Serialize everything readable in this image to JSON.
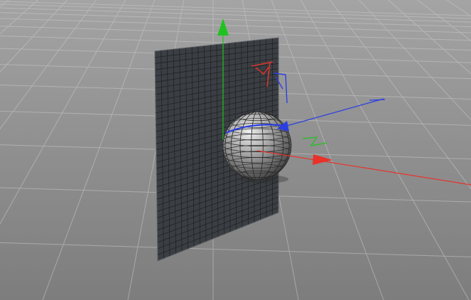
{
  "viewport": {
    "background_top": "#a4a4a4",
    "background_bottom": "#7d7d7d",
    "floor_grid_color": "#c9c9c9"
  },
  "plane": {
    "fill": "#3b3f43",
    "grid_color": "#1c1f22",
    "edge_color": "#5d6165"
  },
  "sphere": {
    "highlight": "#eeeeee",
    "midtone": "#9a9a9a",
    "shadow": "#3e3e3e",
    "wire_color": "#2a2a2a"
  },
  "axes": {
    "x_color": "#e8322a",
    "y_color": "#1fc31f",
    "z_color": "#2b3fe0"
  },
  "icons": {
    "move_x": "arrow-right-icon",
    "move_y": "arrow-up-icon",
    "move_z": "arrow-diagonal-icon",
    "rotate_band": "rotation-band-icon",
    "plane_handle": "plane-handle-icon"
  }
}
